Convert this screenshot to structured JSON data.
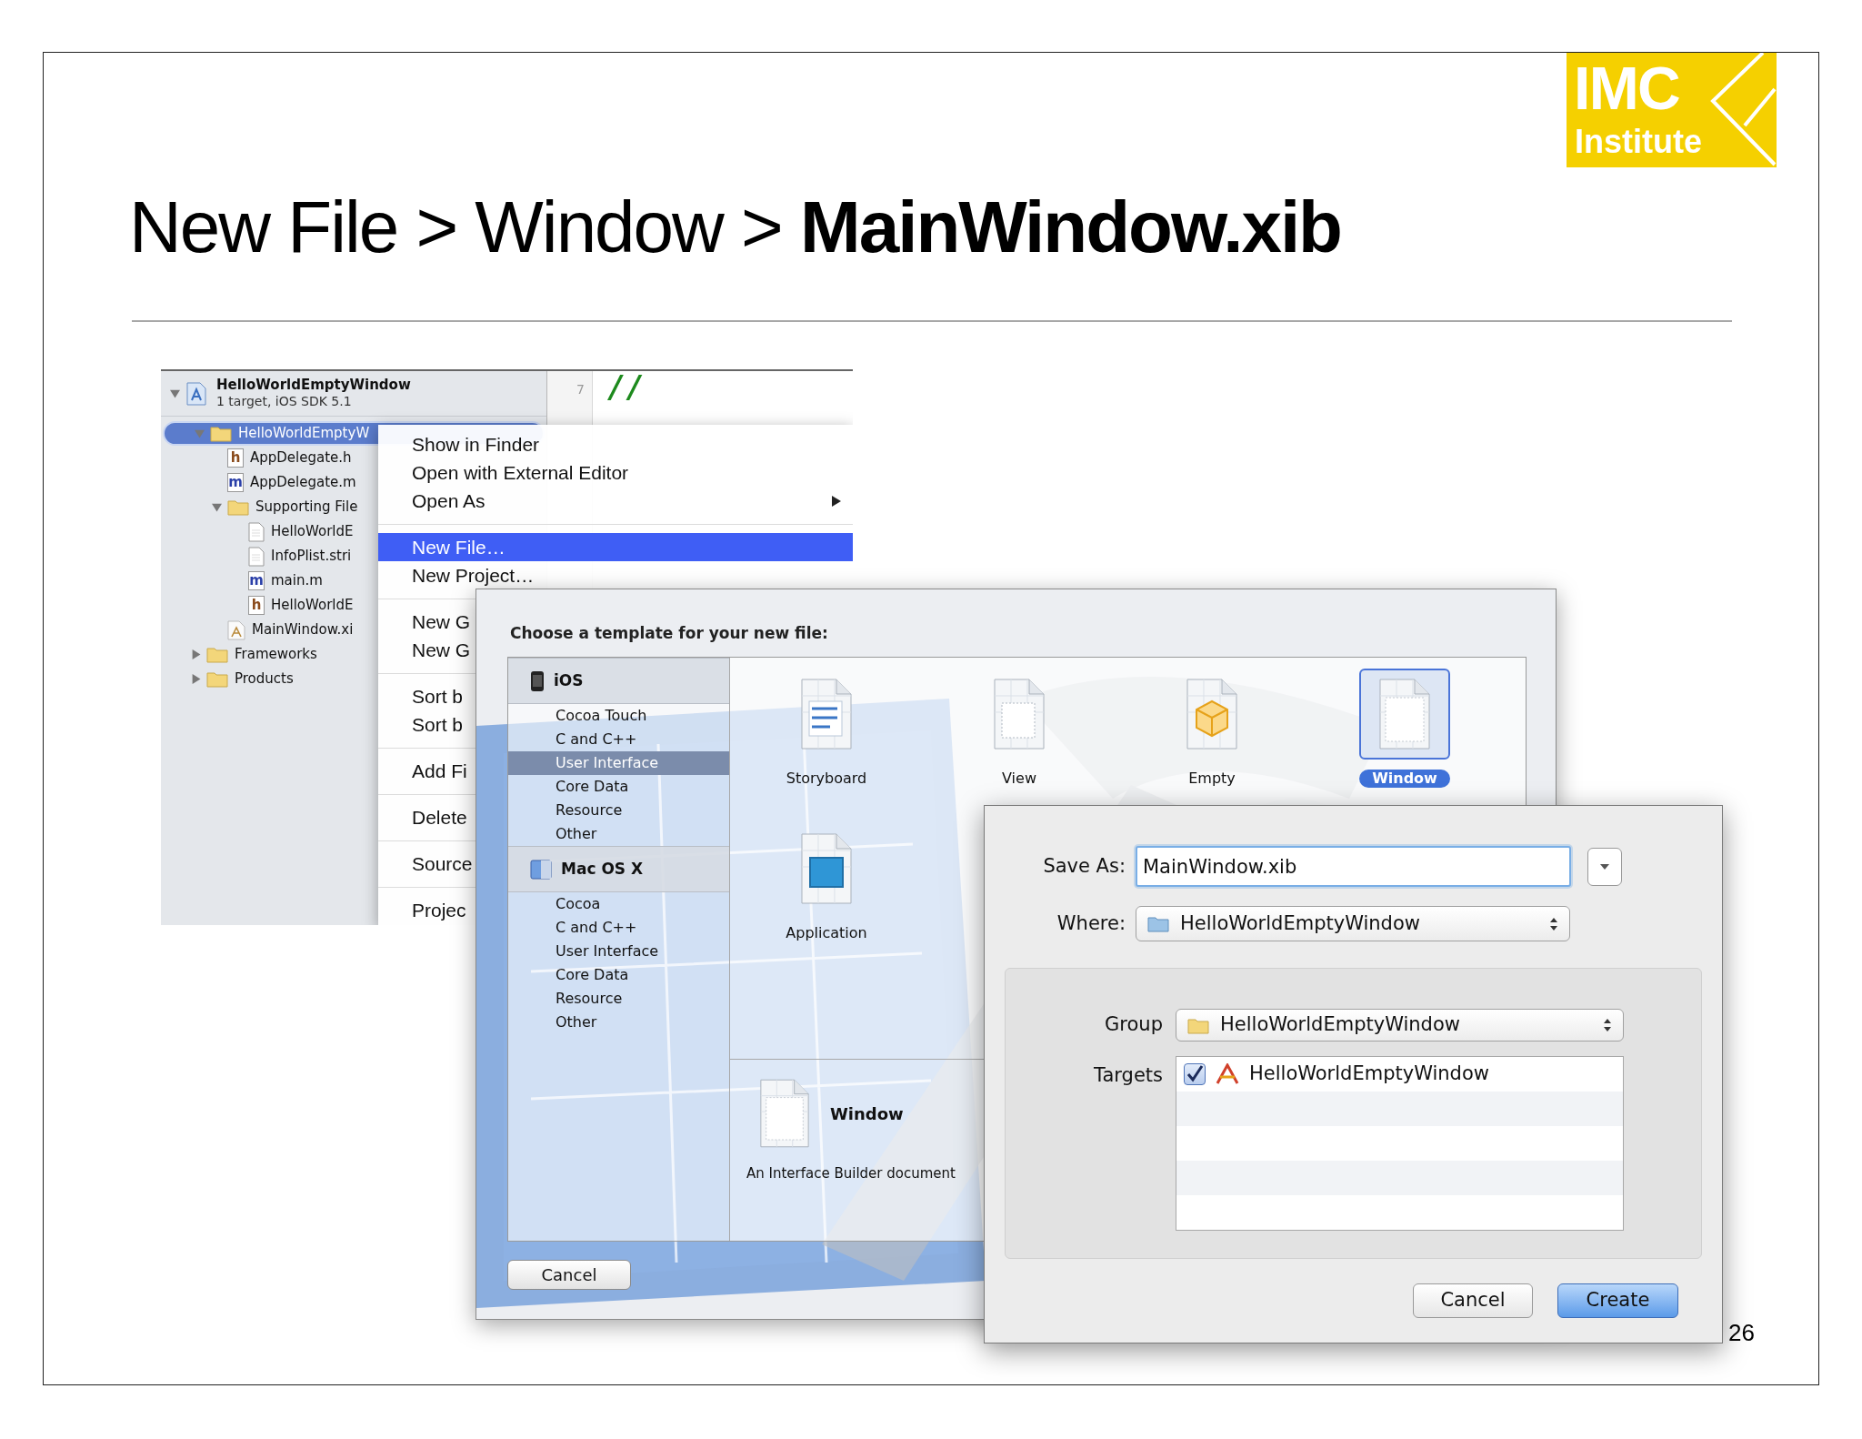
{
  "slide": {
    "title": "New File > Window > **MainWindow.xib**",
    "page_number": "26",
    "logo": {
      "title": "IMC",
      "subtitle": "Institute"
    }
  },
  "navigator": {
    "project": {
      "name": "HelloWorldEmptyWindow",
      "subtitle": "1 target, iOS SDK 5.1",
      "expanded": true
    },
    "items": [
      {
        "label": "HelloWorldEmptyW",
        "kind": "folder",
        "expanded": true,
        "selected": true,
        "children": [
          {
            "label": "AppDelegate.h",
            "kind": "source",
            "badge": "h",
            "color": "#8a4b1c",
            "selected": false
          },
          {
            "label": "AppDelegate.m",
            "kind": "source",
            "badge": "m",
            "color": "#2a3fa8",
            "selected": false
          },
          {
            "label": "Supporting File",
            "kind": "folder",
            "expanded": true,
            "selected": false,
            "children": [
              {
                "label": "HelloWorldE",
                "kind": "document",
                "selected": false
              },
              {
                "label": "InfoPlist.stri",
                "kind": "document",
                "selected": false
              },
              {
                "label": "main.m",
                "kind": "source",
                "badge": "m",
                "color": "#2a3fa8",
                "selected": false
              },
              {
                "label": "HelloWorldE",
                "kind": "source",
                "badge": "h",
                "color": "#8a4b1c",
                "selected": false
              }
            ]
          },
          {
            "label": "MainWindow.xi",
            "kind": "interface",
            "selected": false
          }
        ]
      },
      {
        "label": "Frameworks",
        "kind": "folder",
        "expanded": false,
        "selected": false
      },
      {
        "label": "Products",
        "kind": "folder",
        "expanded": false,
        "selected": false
      }
    ]
  },
  "editor": {
    "line_number": "7",
    "code": "//"
  },
  "context_menu": {
    "groups": [
      [
        {
          "label": "Show in Finder",
          "selected": false,
          "submenu": false
        },
        {
          "label": "Open with External Editor",
          "selected": false,
          "submenu": false
        },
        {
          "label": "Open As",
          "selected": false,
          "submenu": true
        }
      ],
      [
        {
          "label": "New File…",
          "selected": true,
          "submenu": false
        },
        {
          "label": "New Project…",
          "selected": false,
          "submenu": false
        }
      ],
      [
        {
          "label": "New G",
          "selected": false,
          "submenu": false
        },
        {
          "label": "New G",
          "selected": false,
          "submenu": false
        }
      ],
      [
        {
          "label": "Sort b",
          "selected": false,
          "submenu": false
        },
        {
          "label": "Sort b",
          "selected": false,
          "submenu": false
        }
      ],
      [
        {
          "label": "Add Fi",
          "selected": false,
          "submenu": false
        }
      ],
      [
        {
          "label": "Delete",
          "selected": false,
          "submenu": false
        }
      ],
      [
        {
          "label": "Source",
          "selected": false,
          "submenu": false
        }
      ],
      [
        {
          "label": "Projec",
          "selected": false,
          "submenu": false
        }
      ]
    ]
  },
  "template_dialog": {
    "title": "Choose a template for your new file:",
    "platforms": [
      {
        "name": "iOS",
        "kind": "ios",
        "categories": [
          {
            "label": "Cocoa Touch",
            "selected": false
          },
          {
            "label": "C and C++",
            "selected": false
          },
          {
            "label": "User Interface",
            "selected": true
          },
          {
            "label": "Core Data",
            "selected": false
          },
          {
            "label": "Resource",
            "selected": false
          },
          {
            "label": "Other",
            "selected": false
          }
        ]
      },
      {
        "name": "Mac OS X",
        "kind": "mac",
        "categories": [
          {
            "label": "Cocoa",
            "selected": false
          },
          {
            "label": "C and C++",
            "selected": false
          },
          {
            "label": "User Interface",
            "selected": false
          },
          {
            "label": "Core Data",
            "selected": false
          },
          {
            "label": "Resource",
            "selected": false
          },
          {
            "label": "Other",
            "selected": false
          }
        ]
      }
    ],
    "templates": [
      {
        "label": "Storyboard",
        "kind": "storyboard",
        "selected": false
      },
      {
        "label": "View",
        "kind": "view",
        "selected": false
      },
      {
        "label": "Empty",
        "kind": "empty",
        "selected": false
      },
      {
        "label": "Window",
        "kind": "window",
        "selected": true
      },
      {
        "label": "Application",
        "kind": "application",
        "selected": false
      }
    ],
    "description": {
      "kind": "window",
      "title": "Window",
      "text": "An Interface Builder document"
    },
    "cancel_button": "Cancel"
  },
  "save_dialog": {
    "save_as": {
      "label": "Save As:",
      "value": "MainWindow.xib"
    },
    "where": {
      "label": "Where:",
      "value": "HelloWorldEmptyWindow"
    },
    "group": {
      "label": "Group",
      "value": "HelloWorldEmptyWindow"
    },
    "targets": {
      "label": "Targets",
      "items": [
        {
          "label": "HelloWorldEmptyWindow",
          "checked": true
        }
      ]
    },
    "buttons": [
      {
        "label": "Cancel",
        "default": false
      },
      {
        "label": "Create",
        "default": true
      }
    ]
  }
}
